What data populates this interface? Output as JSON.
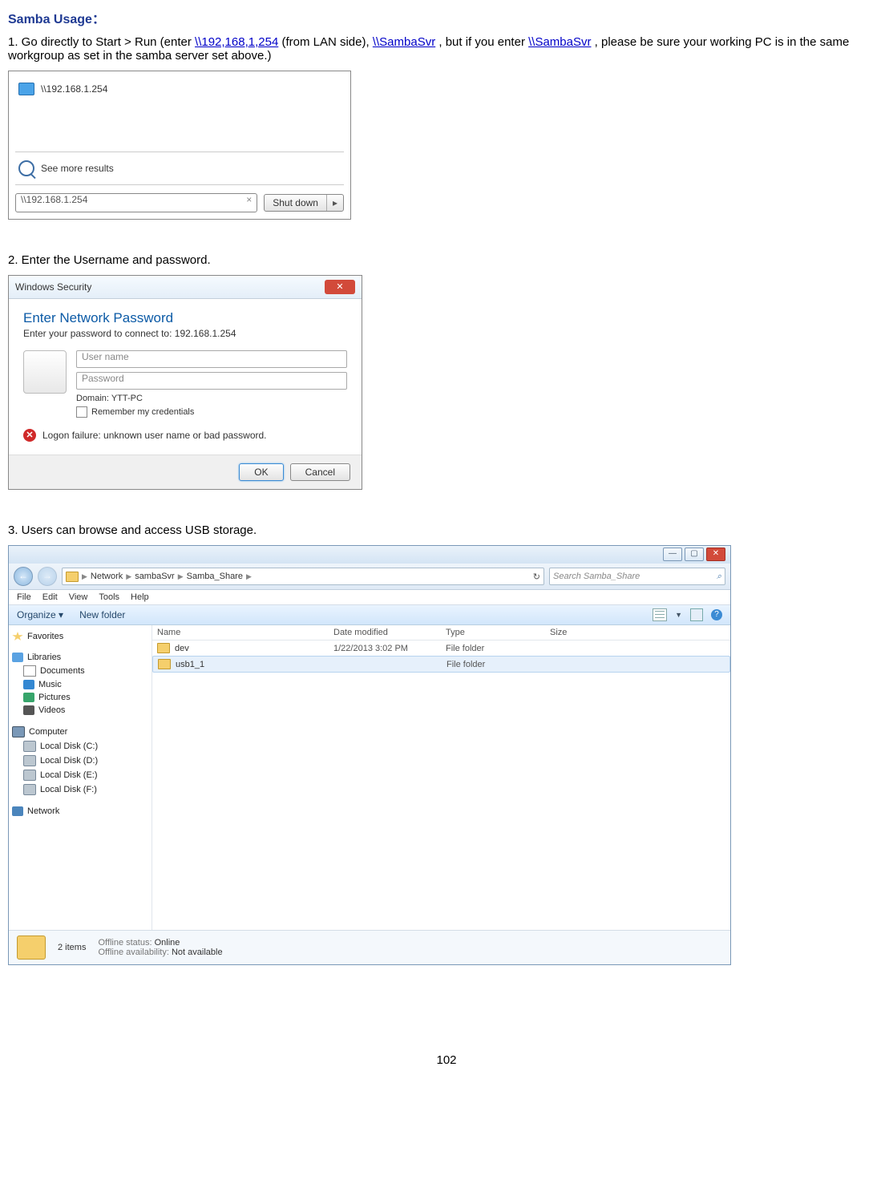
{
  "doc": {
    "title": "Samba Usage：",
    "p1_a": "1. Go directly to Start > Run (enter ",
    "p1_link1": "\\\\192,168,1,254",
    "p1_b": " (from LAN side), ",
    "p1_link2": "\\\\SambaSvr",
    "p1_c": " , but if you enter ",
    "p1_link3": "\\\\SambaSvr",
    "p1_d": ", please be sure your working PC is in the same workgroup as set in the samba server set above.)",
    "p2": "2. Enter the Username and password.",
    "p3": "3. Users can browse and access USB storage.",
    "page_num": "102"
  },
  "fig1": {
    "result": "\\\\192.168.1.254",
    "more": "See more results",
    "input_value": "\\\\192.168.1.254",
    "clear": "×",
    "shutdown": "Shut down",
    "arrow": "▸"
  },
  "fig2": {
    "title": "Windows Security",
    "heading": "Enter Network Password",
    "sub": "Enter your password to connect to: 192.168.1.254",
    "user_ph": "User name",
    "pass_ph": "Password",
    "domain": "Domain: YTT-PC",
    "remember": "Remember my credentials",
    "error": "Logon failure: unknown user name or bad password.",
    "ok": "OK",
    "cancel": "Cancel"
  },
  "fig3": {
    "crumb": [
      "Network",
      "sambaSvr",
      "Samba_Share"
    ],
    "search_ph": "Search Samba_Share",
    "menus": [
      "File",
      "Edit",
      "View",
      "Tools",
      "Help"
    ],
    "organize": "Organize ▾",
    "newfolder": "New folder",
    "tree": {
      "fav": "Favorites",
      "lib": "Libraries",
      "lib_items": [
        "Documents",
        "Music",
        "Pictures",
        "Videos"
      ],
      "comp": "Computer",
      "comp_items": [
        "Local Disk (C:)",
        "Local Disk (D:)",
        "Local Disk (E:)",
        "Local Disk (F:)"
      ],
      "net": "Network"
    },
    "cols": {
      "name": "Name",
      "date": "Date modified",
      "type": "Type",
      "size": "Size"
    },
    "rows": [
      {
        "name": "dev",
        "date": "1/22/2013 3:02 PM",
        "type": "File folder"
      },
      {
        "name": "usb1_1",
        "date": "",
        "type": "File folder"
      }
    ],
    "status": {
      "count": "2 items",
      "offline_status_l": "Offline status:",
      "offline_status_v": "Online",
      "offline_avail_l": "Offline availability:",
      "offline_avail_v": "Not available"
    }
  }
}
